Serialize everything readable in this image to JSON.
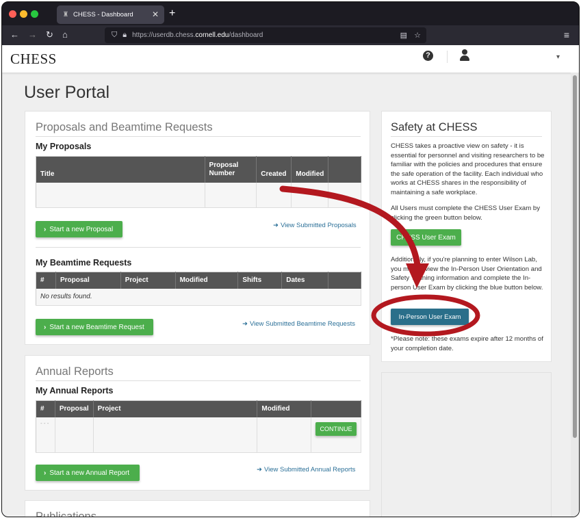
{
  "browser": {
    "tab_title": "CHESS - Dashboard",
    "url_prefix": "https://userdb.chess.",
    "url_domain": "cornell.edu",
    "url_path": "/dashboard"
  },
  "site": {
    "logo": "CHESS",
    "help_icon": "?"
  },
  "page": {
    "title": "User Portal"
  },
  "proposals_panel": {
    "title": "Proposals and Beamtime Requests",
    "my_proposals": {
      "heading": "My Proposals",
      "columns": [
        "Title",
        "Proposal\nNumber",
        "Created",
        "Modified",
        ""
      ],
      "start_button": "Start a new Proposal",
      "view_link": "View Submitted Proposals"
    },
    "my_beamtime": {
      "heading": "My Beamtime Requests",
      "columns": [
        "#",
        "Proposal",
        "Project",
        "Modified",
        "Shifts",
        "Dates",
        ""
      ],
      "empty_text": "No results found.",
      "start_button": "Start a new Beamtime Request",
      "view_link": "View Submitted Beamtime Requests"
    }
  },
  "annual_panel": {
    "title": "Annual Reports",
    "heading": "My Annual Reports",
    "columns": [
      "#",
      "Proposal",
      "Project",
      "Modified",
      ""
    ],
    "row_placeholder": "- - -",
    "continue_button": "CONTINUE",
    "start_button": "Start a new Annual Report",
    "view_link": "View Submitted Annual Reports"
  },
  "publications_panel": {
    "title": "Publications"
  },
  "safety_panel": {
    "title": "Safety at CHESS",
    "para1": "CHESS takes a proactive view on safety - it is essential for personnel and visiting researchers to be familiar with the policies and procedures that ensure the safe operation of the facility. Each individual who works at CHESS shares in the responsibility of maintaining a safe workplace.",
    "para2": "All Users must complete the CHESS User Exam by clicking the green button below.",
    "user_exam_button": "CHESS User Exam",
    "para3": "Additionally, if you're planning to enter Wilson Lab, you must review the In-Person User Orientation and Safety Training information and complete the In-person User Exam by clicking the blue button below.",
    "inperson_button": "In-Person User Exam",
    "note": "*Please note: these exams expire after 12 months of your completion date."
  },
  "colors": {
    "green": "#4cae4c",
    "blue_button": "#2a6f8a",
    "annotation_red": "#b3181f",
    "table_header": "#555555"
  }
}
